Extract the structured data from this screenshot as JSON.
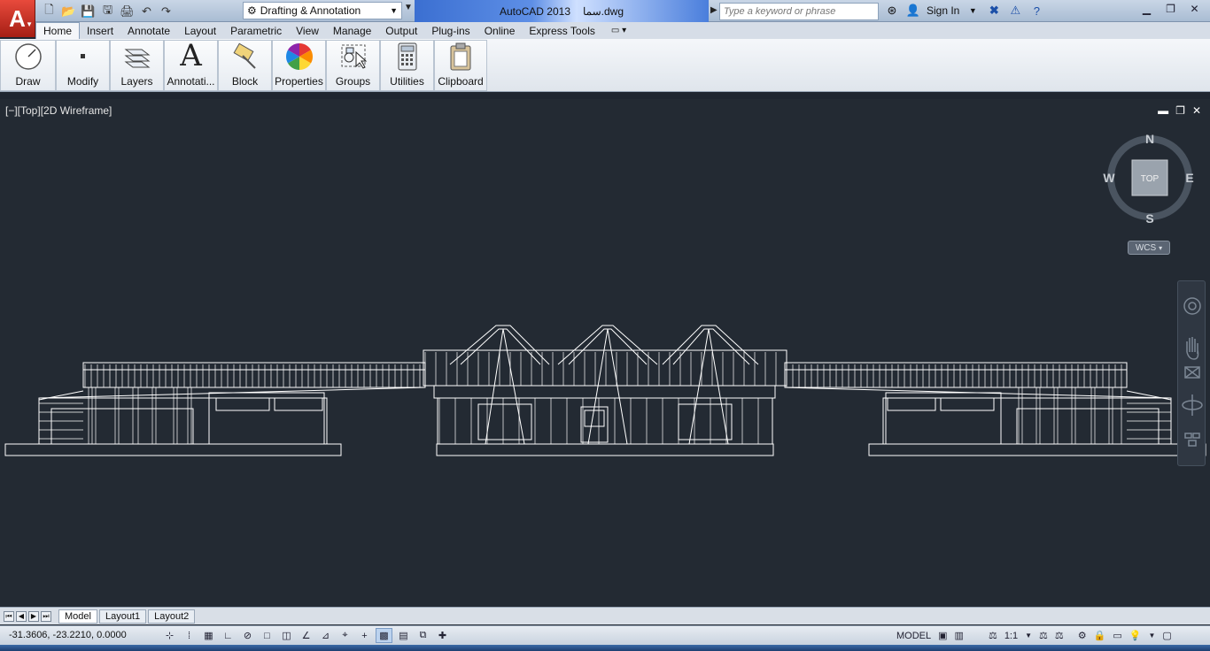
{
  "window": {
    "title": "AutoCAD 2013",
    "file": "ﺳﻤﺎ.dwg",
    "workspace": "Drafting & Annotation",
    "search_placeholder": "Type a keyword or phrase",
    "sign_in": "Sign In"
  },
  "ribbon": {
    "tabs": [
      "Home",
      "Insert",
      "Annotate",
      "Layout",
      "Parametric",
      "View",
      "Manage",
      "Output",
      "Plug-ins",
      "Online",
      "Express Tools"
    ],
    "active_tab": "Home",
    "panels": [
      "Draw",
      "Modify",
      "Layers",
      "Annotati...",
      "Block",
      "Properties",
      "Groups",
      "Utilities",
      "Clipboard"
    ]
  },
  "viewport": {
    "label": "[−][Top][2D Wireframe]",
    "viewcube": {
      "top": "TOP",
      "n": "N",
      "s": "S",
      "e": "E",
      "w": "W"
    },
    "ucs": "WCS"
  },
  "layouts": {
    "tabs": [
      "Model",
      "Layout1",
      "Layout2"
    ],
    "active": "Model"
  },
  "status": {
    "coordinates": "-31.3606, -23.2210, 0.0000",
    "space": "MODEL",
    "annotation_scale": "1:1"
  },
  "colors": {
    "viewport_bg": "#232a33",
    "geometry": "#ffffff",
    "app_button": "#c0291c"
  }
}
